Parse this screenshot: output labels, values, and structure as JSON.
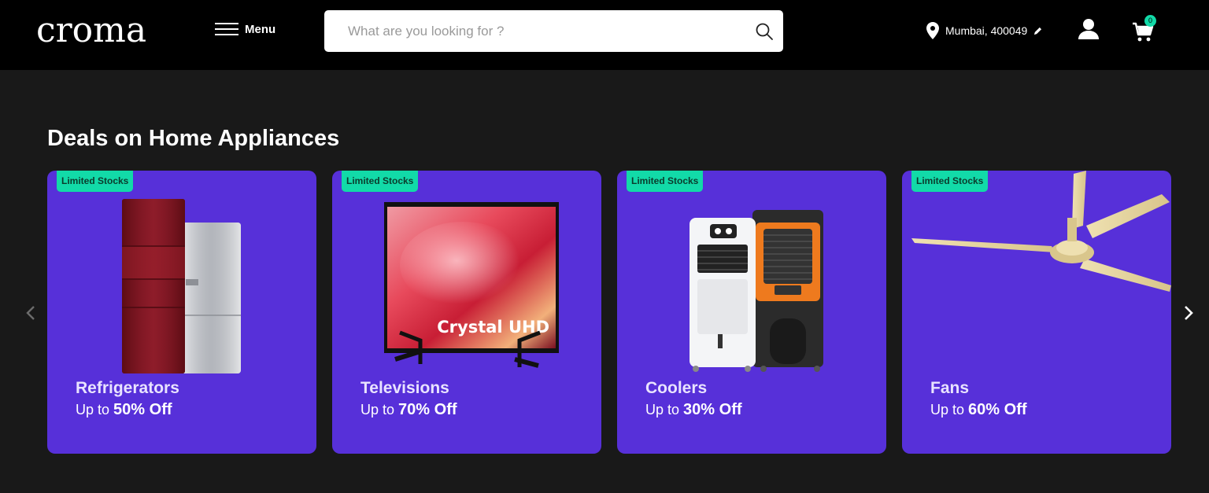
{
  "header": {
    "logo": "croma",
    "menu_label": "Menu",
    "search_placeholder": "What are you looking for ?",
    "location": "Mumbai, 400049",
    "cart_count": "0"
  },
  "section": {
    "title": "Deals on Home Appliances"
  },
  "cards": [
    {
      "badge": "Limited Stocks",
      "name": "Refrigerators",
      "offer_prefix": "Up to",
      "offer": "50% Off",
      "image": "refrigerator-image"
    },
    {
      "badge": "Limited Stocks",
      "name": "Televisions",
      "offer_prefix": "Up to",
      "offer": "70% Off",
      "image": "television-image",
      "tv_text": "Crystal UHD"
    },
    {
      "badge": "Limited Stocks",
      "name": "Coolers",
      "offer_prefix": "Up to",
      "offer": "30% Off",
      "image": "cooler-image"
    },
    {
      "badge": "Limited Stocks",
      "name": "Fans",
      "offer_prefix": "Up to",
      "offer": "60% Off",
      "image": "ceiling-fan-image"
    }
  ],
  "colors": {
    "header_bg": "#000000",
    "page_bg": "#191919",
    "card_bg": "#5730d9",
    "badge_bg": "#12daa8"
  }
}
